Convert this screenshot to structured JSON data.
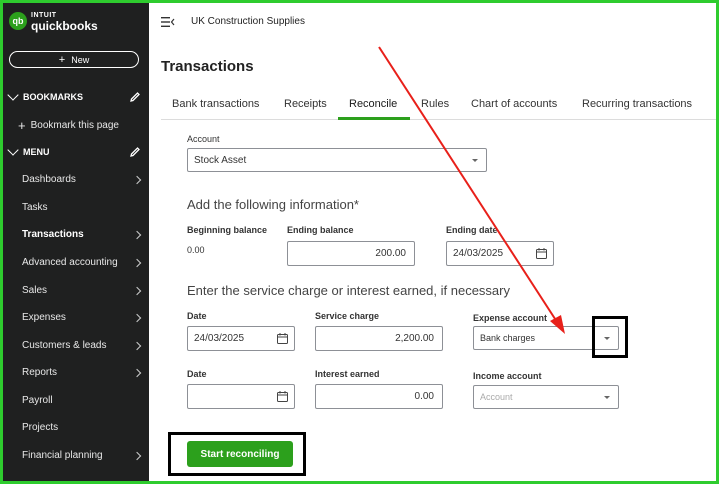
{
  "brand": {
    "intuit": "INTUIT",
    "product": "quickbooks",
    "logo_mark": "qb"
  },
  "sidebar": {
    "new_label": "New",
    "bookmarks_label": "BOOKMARKS",
    "bookmark_item": "Bookmark this page",
    "menu_label": "MENU",
    "items": [
      {
        "label": "Dashboards"
      },
      {
        "label": "Tasks"
      },
      {
        "label": "Transactions"
      },
      {
        "label": "Advanced accounting"
      },
      {
        "label": "Sales"
      },
      {
        "label": "Expenses"
      },
      {
        "label": "Customers & leads"
      },
      {
        "label": "Reports"
      },
      {
        "label": "Payroll"
      },
      {
        "label": "Projects"
      },
      {
        "label": "Financial planning"
      }
    ]
  },
  "header": {
    "company": "UK Construction Supplies",
    "page_title": "Transactions"
  },
  "tabs": [
    {
      "label": "Bank transactions"
    },
    {
      "label": "Receipts"
    },
    {
      "label": "Reconcile"
    },
    {
      "label": "Rules"
    },
    {
      "label": "Chart of accounts"
    },
    {
      "label": "Recurring transactions"
    }
  ],
  "form": {
    "account_label": "Account",
    "account_value": "Stock Asset",
    "info_heading": "Add the following information*",
    "beginning_balance_label": "Beginning balance",
    "beginning_balance_value": "0.00",
    "ending_balance_label": "Ending balance",
    "ending_balance_value": "200.00",
    "ending_date_label": "Ending date",
    "ending_date_value": "24/03/2025",
    "service_heading": "Enter the service charge or interest earned, if necessary",
    "date_label": "Date",
    "service_date_value": "24/03/2025",
    "service_charge_label": "Service charge",
    "service_charge_value": "2,200.00",
    "expense_account_label": "Expense account",
    "expense_account_value": "Bank charges",
    "interest_date_label": "Date",
    "interest_earned_label": "Interest earned",
    "interest_earned_value": "0.00",
    "income_account_label": "Income account",
    "income_account_placeholder": "Account",
    "start_button": "Start reconciling"
  },
  "colors": {
    "accent": "#2ca01c",
    "sidebar_bg": "#1f2020",
    "frame": "#2ecc2e",
    "annotation_arrow": "#e8201a"
  }
}
